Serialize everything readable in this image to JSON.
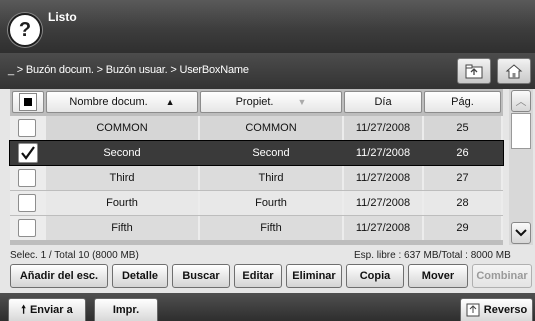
{
  "status": {
    "text": "Listo"
  },
  "help_label": "?",
  "path": "_ > Buzón docum. > Buzón usuar. > UserBoxName",
  "table": {
    "headers": [
      "Nombre docum.",
      "Propiet.",
      "Día",
      "Pág."
    ],
    "rows": [
      {
        "name": "COMMON",
        "owner": "COMMON",
        "date": "11/27/2008",
        "pages": "25",
        "checked": false
      },
      {
        "name": "Second",
        "owner": "Second",
        "date": "11/27/2008",
        "pages": "26",
        "checked": true
      },
      {
        "name": "Third",
        "owner": "Third",
        "date": "11/27/2008",
        "pages": "27",
        "checked": false
      },
      {
        "name": "Fourth",
        "owner": "Fourth",
        "date": "11/27/2008",
        "pages": "28",
        "checked": false
      },
      {
        "name": "Fifth",
        "owner": "Fifth",
        "date": "11/27/2008",
        "pages": "29",
        "checked": false
      }
    ]
  },
  "info": {
    "selection": "Selec. 1  / Total 10 (8000 MB)",
    "space": "Esp. libre : 637 MB/Total : 8000 MB"
  },
  "actions": {
    "add": "Añadir del esc.",
    "detail": "Detalle",
    "search": "Buscar",
    "edit": "Editar",
    "delete": "Eliminar",
    "copy": "Copia",
    "move": "Mover",
    "combine": "Combinar"
  },
  "bottom": {
    "send": "Enviar a",
    "print": "Impr.",
    "back": "Reverso"
  },
  "colors": {
    "selected_row": "#3a3a3a",
    "row_light": "#ececec",
    "row_mid": "#dcdcdc"
  }
}
